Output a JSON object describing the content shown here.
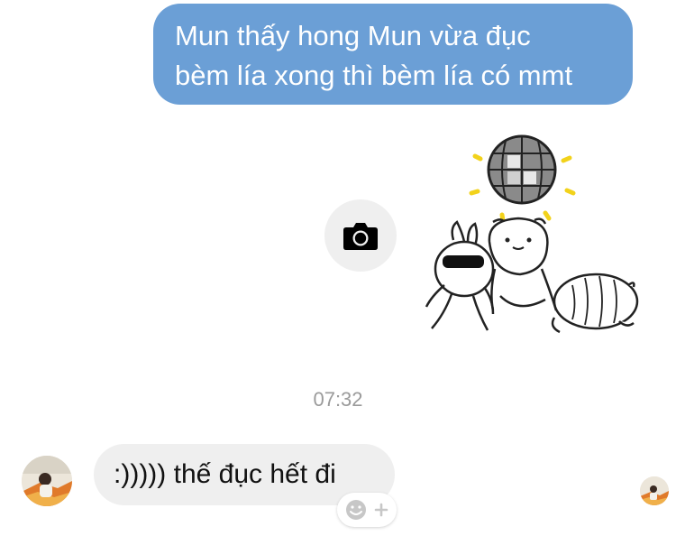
{
  "messages": {
    "outgoing": {
      "line1": "Mun thấy hong Mun vừa đục",
      "line2": "bèm lía xong thì bèm lía có mmt"
    },
    "timestamp": "07:32",
    "incoming": {
      "text": ":))))) thế đục hết đi"
    }
  },
  "icons": {
    "camera": "camera-icon",
    "reaction": "smiley-add-reaction-icon",
    "sticker": "disco-animals-sticker"
  },
  "colors": {
    "outgoing_bubble": "#6b9fd6",
    "incoming_bubble": "#efefef",
    "timestamp": "#9a9a9a"
  }
}
